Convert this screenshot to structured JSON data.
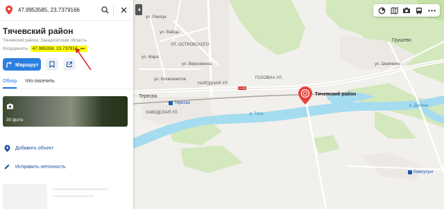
{
  "search": {
    "value": "47.9953585, 23.7379166"
  },
  "place": {
    "title": "Тячевский район",
    "subtitle": "Тячевский район, Закарпатская область",
    "coords_label": "Координаты",
    "coords_value": "47.985359, 23.737917",
    "more": "•••"
  },
  "actions": {
    "route_label": "Маршрут"
  },
  "tabs": [
    {
      "label": "Обзор"
    },
    {
      "label": "Что посетить"
    }
  ],
  "photos": {
    "label": "30 фото"
  },
  "menu": {
    "add_object": "Добавить объект",
    "fix_inaccuracy": "Исправить неточность"
  },
  "map": {
    "marker_label": "Тячевский район",
    "villages": {
      "grushevo": "Грушево",
      "teresva": "Тересва"
    },
    "stations": {
      "teresva": "Тересва",
      "kampulug": "Кимпулунг"
    },
    "road_badge": "H-09",
    "streets": {
      "golovna": "ГОЛОВНА УЛ.",
      "narodnaya": "НАРОДНАЯ УЛ.",
      "vaidy": "ул. Вайды",
      "ostrovskogo": "УЛ. ОСТРОВСКОГО",
      "zavodskaya": "ЗАВОДСКАЯ УЛ.",
      "rakoczi": "ул. Ракоци",
      "mira": "ул. Мира",
      "verhovinna": "ул. Верховинна",
      "kosmonavtov": "ул. Космонавтов",
      "shevchenko": "ул. Шевченко",
      "tisza": "р. Тиса",
      "dolyna": "р. Долина"
    }
  },
  "colors": {
    "accent": "#2d7fe0",
    "highlight": "#ffff00",
    "marker": "#e8413a",
    "water": "#a6dcef",
    "forest": "#cfe6b4"
  }
}
